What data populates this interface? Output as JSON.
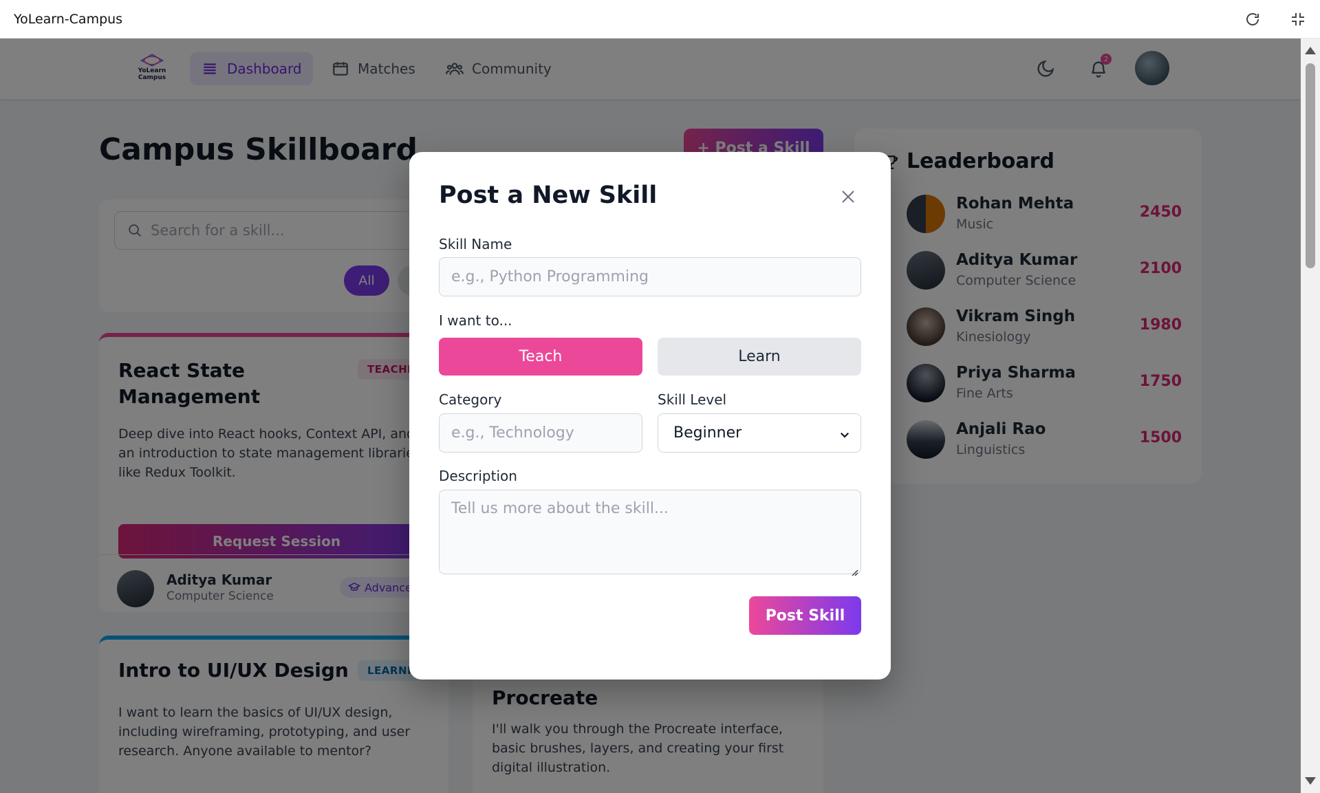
{
  "window": {
    "title": "YoLearn-Campus"
  },
  "nav": {
    "logo_text_1": "YoLearn",
    "logo_text_2": "Campus",
    "items": [
      {
        "label": "Dashboard",
        "icon": "menu-icon"
      },
      {
        "label": "Matches",
        "icon": "calendar-icon"
      },
      {
        "label": "Community",
        "icon": "users-icon"
      }
    ],
    "notification_count": "2"
  },
  "page": {
    "title": "Campus Skillboard",
    "post_button": "+ Post a Skill",
    "search_placeholder": "Search for a skill...",
    "filter_all": "All"
  },
  "cards": [
    {
      "title": "React State Management",
      "badge": "TEACHING",
      "description": "Deep dive into React hooks, Context API, and an introduction to state management libraries like Redux Toolkit.",
      "request_button": "Request Session",
      "owner_name": "Aditya Kumar",
      "owner_dept": "Computer Science",
      "level": "Advanced"
    },
    {
      "title": "Intro to UI/UX Design",
      "badge": "LEARNING",
      "description": "I want to learn the basics of UI/UX design, including wireframing, prototyping, and user research. Anyone available to mentor?"
    },
    {
      "title": "Procreate",
      "description": "I'll walk you through the Procreate interface, basic brushes, layers, and creating your first digital illustration."
    }
  ],
  "leaderboard": {
    "title": "Leaderboard",
    "rows": [
      {
        "name": "Rohan Mehta",
        "dept": "Music",
        "score": "2450"
      },
      {
        "name": "Aditya Kumar",
        "dept": "Computer Science",
        "score": "2100"
      },
      {
        "name": "Vikram Singh",
        "dept": "Kinesiology",
        "score": "1980"
      },
      {
        "name": "Priya Sharma",
        "dept": "Fine Arts",
        "score": "1750"
      },
      {
        "name": "Anjali Rao",
        "dept": "Linguistics",
        "score": "1500"
      }
    ]
  },
  "modal": {
    "title": "Post a New Skill",
    "skill_name_label": "Skill Name",
    "skill_name_placeholder": "e.g., Python Programming",
    "intent_label": "I want to...",
    "teach": "Teach",
    "learn": "Learn",
    "category_label": "Category",
    "category_placeholder": "e.g., Technology",
    "level_label": "Skill Level",
    "level_value": "Beginner",
    "description_label": "Description",
    "description_placeholder": "Tell us more about the skill...",
    "submit": "Post Skill"
  },
  "colors": {
    "accent_pink": "#ec4899",
    "accent_purple": "#7c3aed"
  }
}
